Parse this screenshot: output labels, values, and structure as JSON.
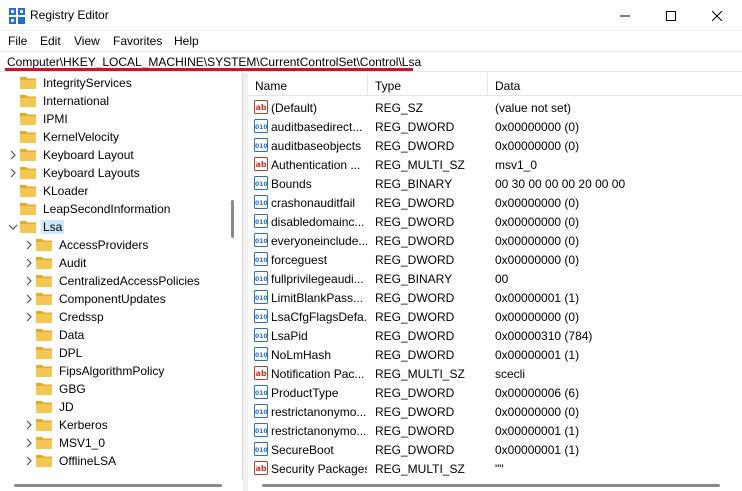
{
  "window": {
    "title": "Registry Editor"
  },
  "menu": [
    "File",
    "Edit",
    "View",
    "Favorites",
    "Help"
  ],
  "address": "Computer\\HKEY_LOCAL_MACHINE\\SYSTEM\\CurrentControlSet\\Control\\Lsa",
  "accent_colors": {
    "highlight_underline": "#d0112b",
    "selection": "#cce8ff",
    "folder": "#f4c653"
  },
  "tree": [
    {
      "label": "IntegrityServices",
      "level": 1,
      "expander": "none",
      "selected": false
    },
    {
      "label": "International",
      "level": 1,
      "expander": "none",
      "selected": false
    },
    {
      "label": "IPMI",
      "level": 1,
      "expander": "none",
      "selected": false
    },
    {
      "label": "KernelVelocity",
      "level": 1,
      "expander": "none",
      "selected": false
    },
    {
      "label": "Keyboard Layout",
      "level": 1,
      "expander": "collapsed",
      "selected": false
    },
    {
      "label": "Keyboard Layouts",
      "level": 1,
      "expander": "collapsed",
      "selected": false
    },
    {
      "label": "KLoader",
      "level": 1,
      "expander": "none",
      "selected": false
    },
    {
      "label": "LeapSecondInformation",
      "level": 1,
      "expander": "none",
      "selected": false
    },
    {
      "label": "Lsa",
      "level": 1,
      "expander": "expanded",
      "selected": true
    },
    {
      "label": "AccessProviders",
      "level": 2,
      "expander": "collapsed",
      "selected": false
    },
    {
      "label": "Audit",
      "level": 2,
      "expander": "collapsed",
      "selected": false
    },
    {
      "label": "CentralizedAccessPolicies",
      "level": 2,
      "expander": "collapsed",
      "selected": false
    },
    {
      "label": "ComponentUpdates",
      "level": 2,
      "expander": "collapsed",
      "selected": false
    },
    {
      "label": "Credssp",
      "level": 2,
      "expander": "collapsed",
      "selected": false
    },
    {
      "label": "Data",
      "level": 2,
      "expander": "none",
      "selected": false
    },
    {
      "label": "DPL",
      "level": 2,
      "expander": "none",
      "selected": false
    },
    {
      "label": "FipsAlgorithmPolicy",
      "level": 2,
      "expander": "none",
      "selected": false
    },
    {
      "label": "GBG",
      "level": 2,
      "expander": "none",
      "selected": false
    },
    {
      "label": "JD",
      "level": 2,
      "expander": "none",
      "selected": false
    },
    {
      "label": "Kerberos",
      "level": 2,
      "expander": "collapsed",
      "selected": false
    },
    {
      "label": "MSV1_0",
      "level": 2,
      "expander": "collapsed",
      "selected": false
    },
    {
      "label": "OfflineLSA",
      "level": 2,
      "expander": "collapsed",
      "selected": false
    }
  ],
  "columns": {
    "name": "Name",
    "type": "Type",
    "data": "Data"
  },
  "values": [
    {
      "icon": "string-value-icon",
      "name": "(Default)",
      "type": "REG_SZ",
      "data": "(value not set)"
    },
    {
      "icon": "binary-value-icon",
      "name": "auditbasedirect...",
      "type": "REG_DWORD",
      "data": "0x00000000 (0)"
    },
    {
      "icon": "binary-value-icon",
      "name": "auditbaseobjects",
      "type": "REG_DWORD",
      "data": "0x00000000 (0)"
    },
    {
      "icon": "string-value-icon",
      "name": "Authentication ...",
      "type": "REG_MULTI_SZ",
      "data": "msv1_0"
    },
    {
      "icon": "binary-value-icon",
      "name": "Bounds",
      "type": "REG_BINARY",
      "data": "00 30 00 00 00 20 00 00"
    },
    {
      "icon": "binary-value-icon",
      "name": "crashonauditfail",
      "type": "REG_DWORD",
      "data": "0x00000000 (0)"
    },
    {
      "icon": "binary-value-icon",
      "name": "disabledomainc...",
      "type": "REG_DWORD",
      "data": "0x00000000 (0)"
    },
    {
      "icon": "binary-value-icon",
      "name": "everyoneinclude...",
      "type": "REG_DWORD",
      "data": "0x00000000 (0)"
    },
    {
      "icon": "binary-value-icon",
      "name": "forceguest",
      "type": "REG_DWORD",
      "data": "0x00000000 (0)"
    },
    {
      "icon": "binary-value-icon",
      "name": "fullprivilegeaudi...",
      "type": "REG_BINARY",
      "data": "00"
    },
    {
      "icon": "binary-value-icon",
      "name": "LimitBlankPass...",
      "type": "REG_DWORD",
      "data": "0x00000001 (1)"
    },
    {
      "icon": "binary-value-icon",
      "name": "LsaCfgFlagsDefa...",
      "type": "REG_DWORD",
      "data": "0x00000000 (0)"
    },
    {
      "icon": "binary-value-icon",
      "name": "LsaPid",
      "type": "REG_DWORD",
      "data": "0x00000310 (784)"
    },
    {
      "icon": "binary-value-icon",
      "name": "NoLmHash",
      "type": "REG_DWORD",
      "data": "0x00000001 (1)"
    },
    {
      "icon": "string-value-icon",
      "name": "Notification Pac...",
      "type": "REG_MULTI_SZ",
      "data": "scecli"
    },
    {
      "icon": "binary-value-icon",
      "name": "ProductType",
      "type": "REG_DWORD",
      "data": "0x00000006 (6)"
    },
    {
      "icon": "binary-value-icon",
      "name": "restrictanonymo...",
      "type": "REG_DWORD",
      "data": "0x00000000 (0)"
    },
    {
      "icon": "binary-value-icon",
      "name": "restrictanonymo...",
      "type": "REG_DWORD",
      "data": "0x00000001 (1)"
    },
    {
      "icon": "binary-value-icon",
      "name": "SecureBoot",
      "type": "REG_DWORD",
      "data": "0x00000001 (1)"
    },
    {
      "icon": "string-value-icon",
      "name": "Security Packages",
      "type": "REG_MULTI_SZ",
      "data": "\"\""
    }
  ]
}
